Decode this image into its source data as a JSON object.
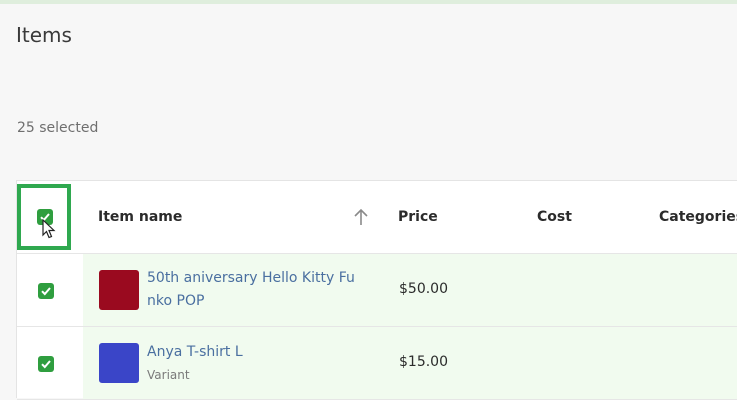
{
  "header": {
    "title": "Items"
  },
  "selection": {
    "count_label": "25 selected"
  },
  "table": {
    "columns": [
      "Item name",
      "Price",
      "Cost",
      "Categories"
    ],
    "sort": {
      "column": "Item name",
      "direction": "ascending",
      "icon": "arrow-up-icon"
    },
    "select_all_checked": true,
    "rows": [
      {
        "checked": true,
        "thumb_color": "#9a0a1f",
        "name_line1": "50th aniversary Hello Kitty Fu",
        "name_line2": "nko POP",
        "subtitle": "",
        "price": "$50.00",
        "cost": "",
        "categories": ""
      },
      {
        "checked": true,
        "thumb_color": "#3a45c8",
        "name_line1": "Anya T-shirt L",
        "name_line2": "",
        "subtitle": "Variant",
        "price": "$15.00",
        "cost": "",
        "categories": ""
      }
    ]
  },
  "colors": {
    "accent_green": "#2f9e3f",
    "focus_outline": "#2fa84f",
    "selected_row_bg": "#f1fbef",
    "link_blue": "#4a6fa0"
  }
}
